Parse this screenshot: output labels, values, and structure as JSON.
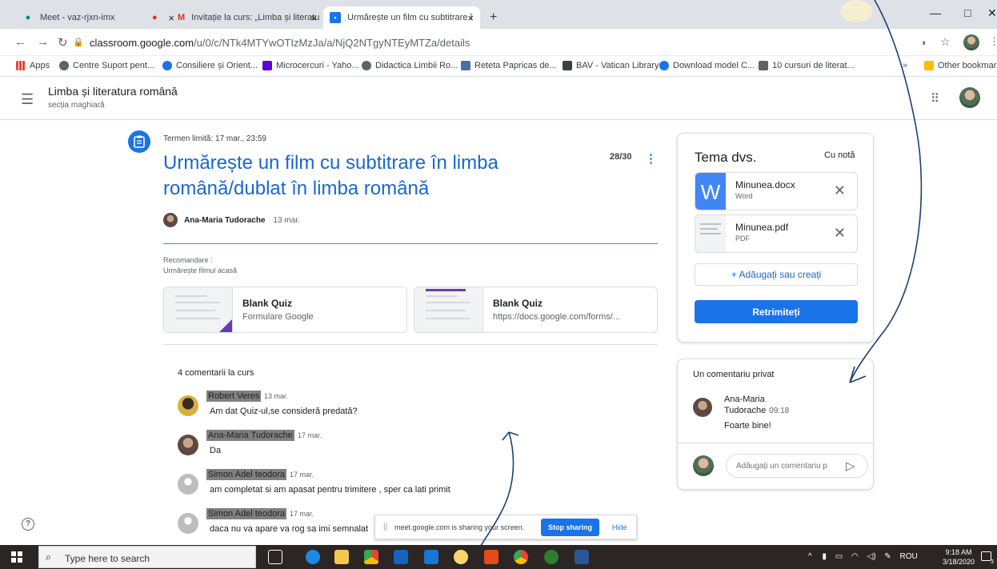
{
  "browser": {
    "tabs": [
      {
        "label": "Meet - vaz-rjxn-imx",
        "icon": "meet-icon"
      },
      {
        "label": "Invitație la curs: „Limba și literatu",
        "icon": "gmail-icon"
      },
      {
        "label": "Urmărește un film cu subtitrare î",
        "icon": "classroom-icon"
      }
    ],
    "new_tab": "+",
    "url_host": "classroom.google.com",
    "url_path": "/u/0/c/NTk4MTYwOTIzMzJa/a/NjQ2NTgyNTEyMTZa/details",
    "bookmarks": [
      {
        "label": "Apps",
        "color": "#ea4335"
      },
      {
        "label": "Centre Suport pent...",
        "color": "#5f6368"
      },
      {
        "label": "Consiliere și Orient...",
        "color": "#1a73e8"
      },
      {
        "label": "Microcercuri - Yaho...",
        "color": "#6001d2"
      },
      {
        "label": "Didactica Limbii Ro...",
        "color": "#5f6368"
      },
      {
        "label": "Reteta Papricas de...",
        "color": "#4a6fa5"
      },
      {
        "label": "BAV - Vatican Library",
        "color": "#3c4043"
      },
      {
        "label": "Download model C...",
        "color": "#1a73e8"
      },
      {
        "label": "10 cursuri de literat...",
        "color": "#5f6368"
      },
      {
        "label": "Other bookmarks",
        "color": "#fbbc04"
      }
    ]
  },
  "classroom": {
    "course_title": "Limba și literatura română",
    "course_section": "secția maghiară"
  },
  "assignment": {
    "deadline": "Termen limită: 17 mar., 23:59",
    "title": "Urmărește un film cu subtitrare în limba română/dublat în limba română",
    "points": "28/30",
    "author": "Ana-Maria Tudorache",
    "date": "13 mar.",
    "rec_label": "Recomandare :",
    "rec_text": "Urmărește filmul acasă",
    "attachments": [
      {
        "title": "Blank Quiz",
        "subtitle": "Formulare Google"
      },
      {
        "title": "Blank Quiz",
        "subtitle": "https://docs.google.com/forms/..."
      }
    ]
  },
  "comments": {
    "count_label": "4 comentarii la curs",
    "items": [
      {
        "name": "Robert Veres",
        "date": "13 mar.",
        "text": "Am dat Quiz-ul,se consideră predată?"
      },
      {
        "name": "Ana-Maria Tudorache",
        "date": "17 mar.",
        "text": "Da"
      },
      {
        "name": "Simon Adel teodora",
        "date": "17 mar.",
        "text": "am completat si am apasat pentru trimitere , sper ca lati primit"
      },
      {
        "name": "Simon Adel teodora",
        "date": "17 mar.",
        "text": "daca nu va apare va rog sa imi semnalat"
      }
    ]
  },
  "your_work": {
    "heading": "Tema dvs.",
    "status": "Cu notă",
    "files": [
      {
        "name": "Minunea.docx",
        "kind": "Word"
      },
      {
        "name": "Minunea.pdf",
        "kind": "PDF"
      }
    ],
    "add_label": "+  Adăugați sau creați",
    "resubmit_label": "Retrimiteți"
  },
  "private_comment": {
    "heading": "Un comentariu privat",
    "author": "Ana-Maria Tudorache",
    "time": "09:18",
    "text": "Foarte bine!",
    "input_placeholder": "Adăugați un comentariu p"
  },
  "share_bar": {
    "message": "meet.google.com is sharing your screen.",
    "stop_label": "Stop sharing",
    "hide_label": "Hide"
  },
  "taskbar": {
    "search_placeholder": "Type here to search",
    "lang": "ROU",
    "time": "9:18 AM",
    "date": "3/18/2020",
    "notif_count": "3"
  },
  "colors": {
    "accent": "#1a73e8",
    "title_blue": "#1967d2",
    "annotation_arrow": "#1f3f73"
  }
}
